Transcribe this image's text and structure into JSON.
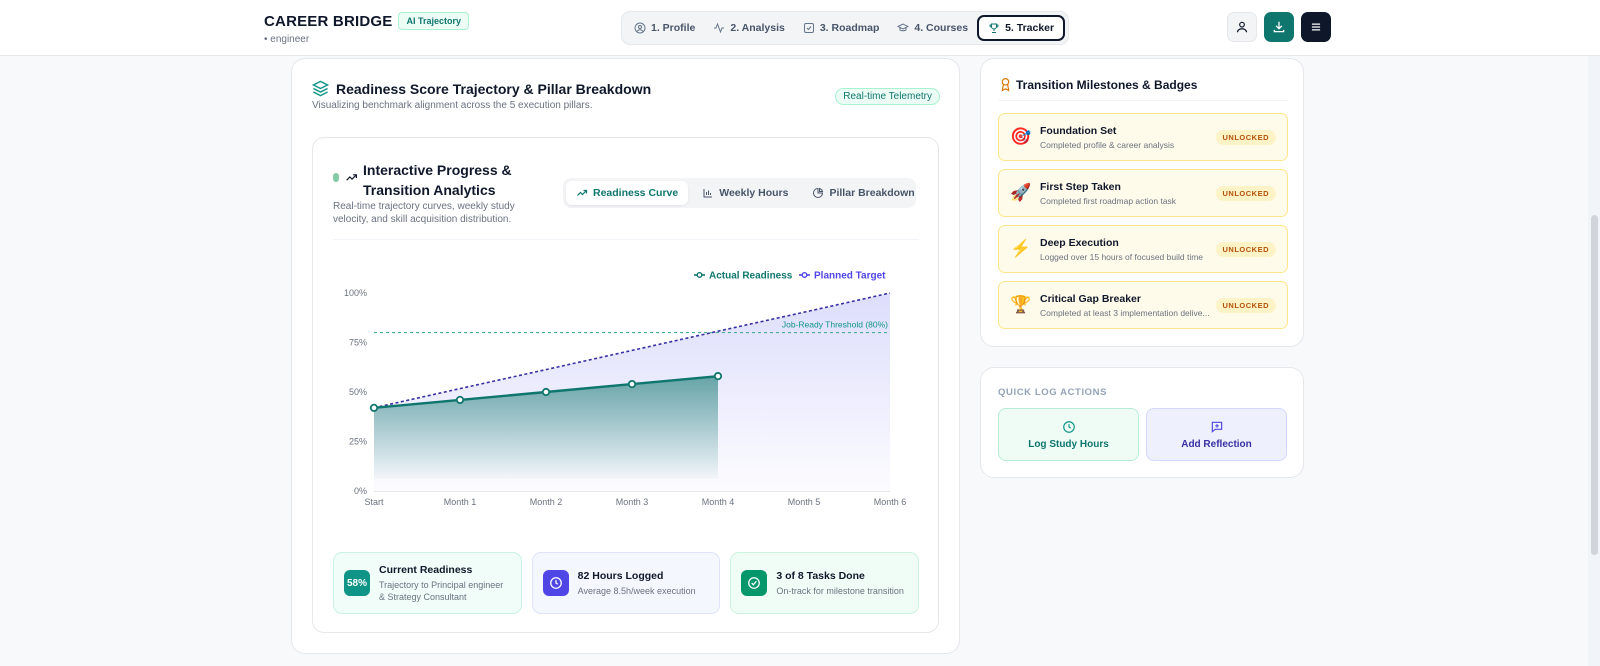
{
  "header": {
    "brand": "CAREER BRIDGE",
    "badge": "AI Trajectory",
    "subtitle": "• engineer",
    "steps": [
      {
        "label": "1. Profile",
        "icon": "user-circle-icon"
      },
      {
        "label": "2. Analysis",
        "icon": "activity-icon"
      },
      {
        "label": "3. Roadmap",
        "icon": "check-square-icon"
      },
      {
        "label": "4. Courses",
        "icon": "graduation-cap-icon"
      },
      {
        "label": "5. Tracker",
        "icon": "trophy-icon",
        "active": true
      }
    ],
    "actions": [
      "user-icon",
      "download-icon",
      "menu-icon"
    ]
  },
  "main": {
    "title": "Readiness Score Trajectory & Pillar Breakdown",
    "subtitle": "Visualizing benchmark alignment across the 5 execution pillars.",
    "badge": "Real-time Telemetry",
    "panel": {
      "title": "Interactive Progress & Transition Analytics",
      "subtitle": "Real-time trajectory curves, weekly study velocity, and skill acquisition distribution.",
      "tabs": [
        {
          "label": "Readiness Curve",
          "icon": "trending-up-icon",
          "active": true
        },
        {
          "label": "Weekly Hours",
          "icon": "bar-chart-icon"
        },
        {
          "label": "Pillar Breakdown",
          "icon": "pie-chart-icon"
        }
      ]
    },
    "stats": [
      {
        "badge": "58%",
        "title": "Current Readiness",
        "sub": "Trajectory to Principal engineer & Strategy Consultant",
        "color": "#0f9488"
      },
      {
        "title": "82 Hours Logged",
        "sub": "Average 8.5h/week execution",
        "icon": "clock-icon",
        "color": "#4f46e5"
      },
      {
        "title": "3 of 8 Tasks Done",
        "sub": "On-track for milestone transition",
        "icon": "check-circle-icon",
        "color": "#059669"
      }
    ]
  },
  "chart_data": {
    "type": "area",
    "categories": [
      "Start",
      "Month 1",
      "Month 2",
      "Month 3",
      "Month 4",
      "Month 5",
      "Month 6"
    ],
    "series": [
      {
        "name": "Actual Readiness",
        "values": [
          42,
          46,
          50,
          54,
          58,
          null,
          null
        ],
        "color": "#0f766e"
      },
      {
        "name": "Planned Target",
        "values": [
          42,
          51.7,
          61.3,
          71,
          80.7,
          90.3,
          100
        ],
        "color": "#4f46e5"
      }
    ],
    "yticks": [
      "0%",
      "25%",
      "50%",
      "75%",
      "100%"
    ],
    "ylim": [
      0,
      100
    ],
    "threshold": {
      "value": 80,
      "label": "Job-Ready Threshold (80%)"
    },
    "legend": "top-right"
  },
  "milestones": {
    "title": "Transition Milestones & Badges",
    "items": [
      {
        "emoji": "🎯",
        "title": "Foundation Set",
        "sub": "Completed profile & career analysis",
        "status": "UNLOCKED"
      },
      {
        "emoji": "🚀",
        "title": "First Step Taken",
        "sub": "Completed first roadmap action task",
        "status": "UNLOCKED"
      },
      {
        "emoji": "⚡",
        "title": "Deep Execution",
        "sub": "Logged over 15 hours of focused build time",
        "status": "UNLOCKED"
      },
      {
        "emoji": "🏆",
        "title": "Critical Gap Breaker",
        "sub": "Completed at least 3 implementation delive...",
        "status": "UNLOCKED"
      }
    ]
  },
  "quick_log": {
    "title": "QUICK LOG ACTIONS",
    "buttons": [
      {
        "label": "Log Study Hours",
        "icon": "clock-icon"
      },
      {
        "label": "Add Reflection",
        "icon": "message-plus-icon"
      }
    ]
  }
}
